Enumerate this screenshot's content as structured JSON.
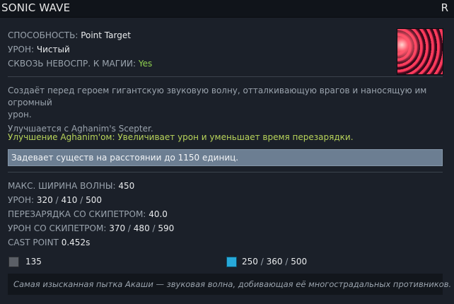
{
  "ability": {
    "name": "SONIC WAVE",
    "hotkey": "R",
    "icon": "sonic-wave-ability-icon"
  },
  "stats_top": [
    {
      "label": "СПОСОБНОСТЬ:",
      "value": "Point Target"
    },
    {
      "label": "УРОН:",
      "value": "Чистый"
    },
    {
      "label": "СКВОЗЬ НЕВОСПР. К МАГИИ:",
      "value": "Yes"
    }
  ],
  "description": {
    "line1": "Создаёт перед героем гигантскую звуковую волну, отталкивающую врагов и наносящую им огромный",
    "line2": "урон.",
    "line3": "Улучшается с Aghanim's Scepter."
  },
  "upgrade_text": "Улучшение Aghanim'ом: Увеличивает урон и уменьшает время перезарядки.",
  "note": "Задевает существ на расстоянии до 1150 единиц.",
  "stats_bottom": [
    {
      "label": "МАКС. ШИРИНА ВОЛНЫ:",
      "v1": "450"
    },
    {
      "label": "УРОН:",
      "v1": "320",
      "v2": "410",
      "v3": "500"
    },
    {
      "label": "ПЕРЕЗАРЯДКА СО СКИПЕТРОМ:",
      "v1": "40.0"
    },
    {
      "label": "УРОН СО СКИПЕТРОМ:",
      "v1": "370",
      "v2": "480",
      "v3": "590"
    },
    {
      "label": "CAST POINT",
      "v1": "0.452s"
    }
  ],
  "costs": {
    "cooldown_icon": "cooldown-icon",
    "cooldown": "135",
    "mana_icon": "mana-icon",
    "mana1": "250",
    "mana2": "360",
    "mana3": "500",
    "sep": "/"
  },
  "lore": "Самая изысканная пытка Акаши — звуковая волна, добивающая её многострадальных противников.",
  "colors": {
    "background": "#1b2029",
    "header": "#10141a",
    "upgrade": "#b8d45a",
    "yes": "#8fd14f",
    "note_box": "#6c7e92",
    "mana": "#27a9d9"
  }
}
